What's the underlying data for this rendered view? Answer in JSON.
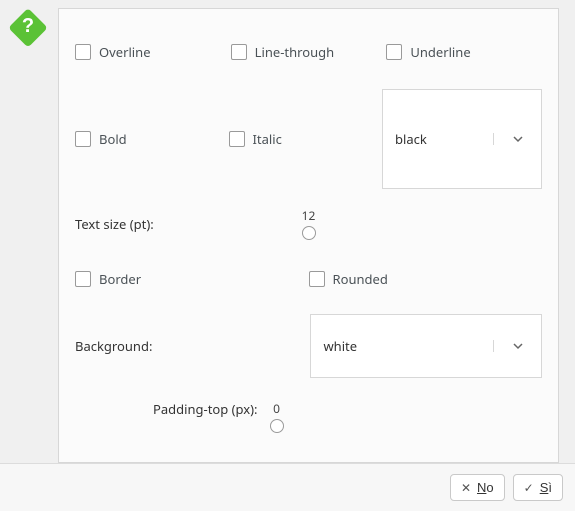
{
  "checks": {
    "overline": "Overline",
    "linethrough": "Line-through",
    "underline": "Underline",
    "bold": "Bold",
    "italic": "Italic",
    "border": "Border",
    "rounded": "Rounded"
  },
  "selects": {
    "textColor": "black",
    "background": "white"
  },
  "labels": {
    "textSize": "Text size (pt):",
    "background": "Background:",
    "paddingTop": "Padding-top (px):"
  },
  "sliders": {
    "textSize": "12",
    "paddingTop": "0"
  },
  "buttons": {
    "noPrefix": "N",
    "noRest": "o",
    "yesPrefix": "S",
    "yesRest": "ì"
  }
}
